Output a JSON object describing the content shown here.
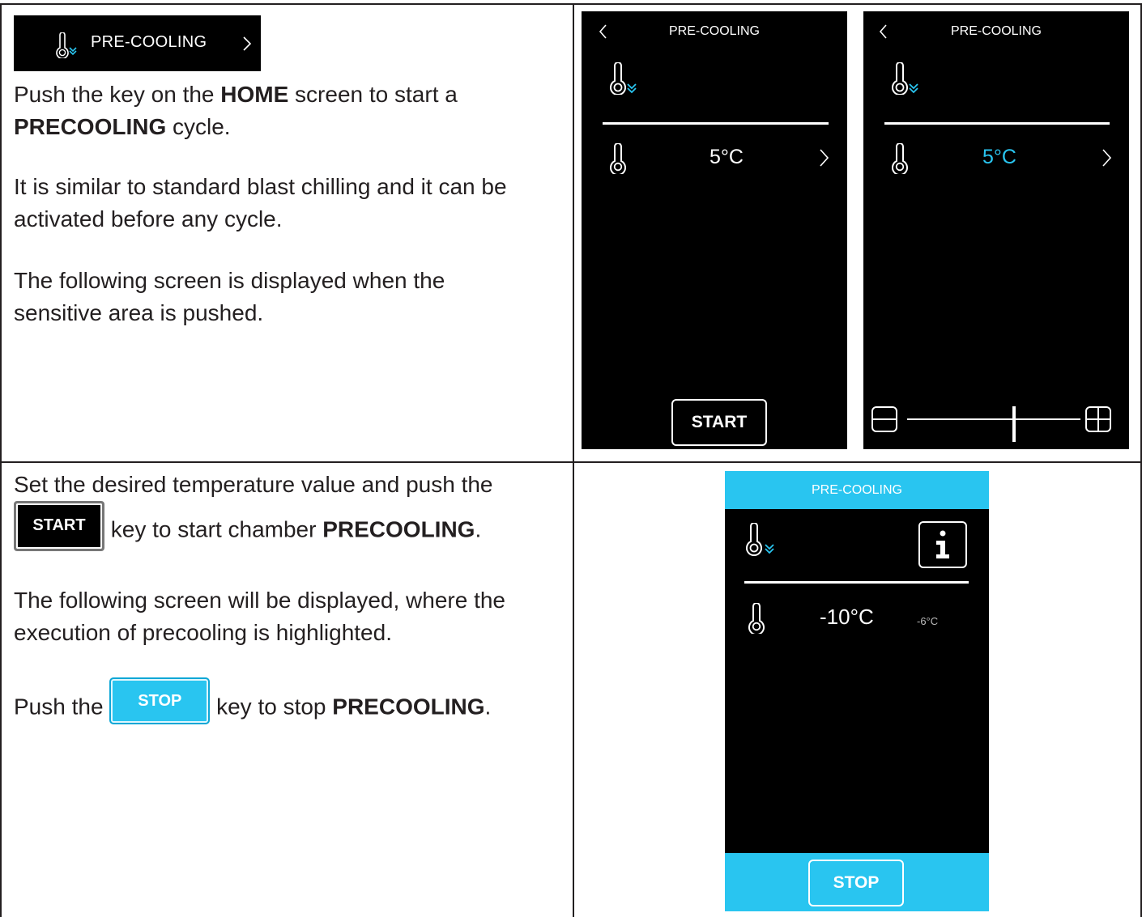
{
  "home_key": {
    "label": "PRE-COOLING",
    "icon": "thermometer-down-icon",
    "chevron": "chevron-right-icon"
  },
  "intro": {
    "p1_prefix": "Push the key on the ",
    "p1_bold1": "HOME",
    "p1_mid": " screen to start a",
    "p1_bold2": "PRECOOLING",
    "p1_suffix": " cycle.",
    "p2": "It is similar to standard blast chilling and it can be activated before any cycle.",
    "p3": "The following screen is displayed when the sensitive area is pushed."
  },
  "screen1": {
    "title": "PRE-COOLING",
    "temp": "5°C",
    "start_label": "START"
  },
  "screen2": {
    "title": "PRE-COOLING",
    "temp": "5°C",
    "accent": "#29c5f0",
    "slider_position_fraction": 0.5
  },
  "instructions": {
    "l1": "Set the desired temperature value and push the",
    "start_label": "START",
    "l2_mid": " key to start chamber ",
    "l2_bold": "PRECOOLING",
    "l2_end": ".",
    "p2": "The following screen will be displayed, where the execution of precooling is highlighted.",
    "p3_prefix": "Push the ",
    "stop_label": "STOP",
    "p3_mid": " key to stop ",
    "p3_bold": "PRECOOLING",
    "p3_end": "."
  },
  "screen3": {
    "title": "PRE-COOLING",
    "temp": "-10°C",
    "probe_temp": "-6°C",
    "stop_label": "STOP",
    "accent": "#29c5f0"
  }
}
